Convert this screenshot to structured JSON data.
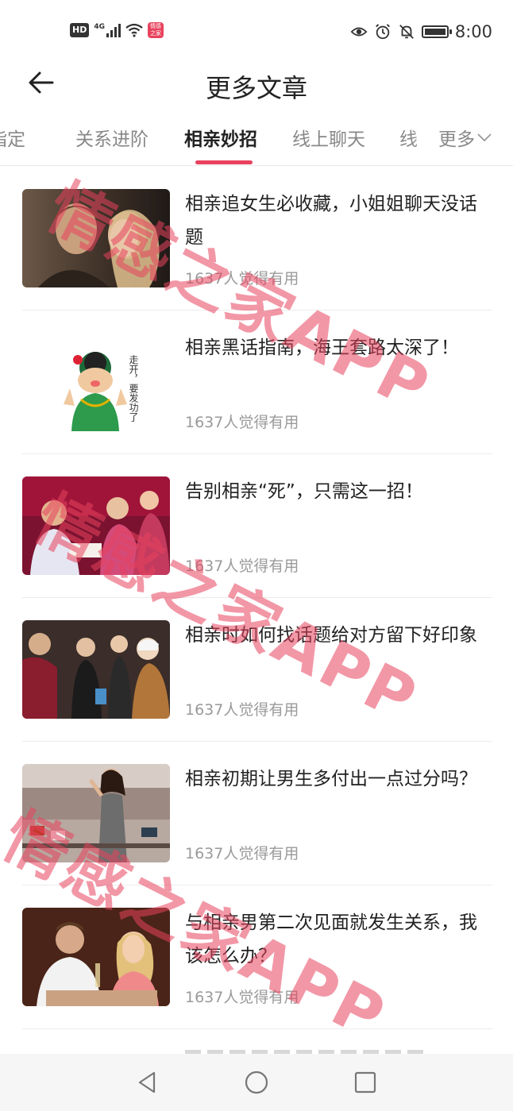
{
  "status_bar": {
    "hd": "HD",
    "network": "4G",
    "app_badge": "情感之家",
    "time": "8:00"
  },
  "header": {
    "title": "更多文章"
  },
  "tabs": [
    {
      "label": "指定"
    },
    {
      "label": "关系进阶"
    },
    {
      "label": "相亲妙招"
    },
    {
      "label": "线上聊天"
    },
    {
      "label": "线"
    }
  ],
  "active_tab": "相亲妙招",
  "more_tab": {
    "label": "更多"
  },
  "articles": [
    {
      "title": "相亲追女生必收藏，小姐姐聊天没话题",
      "meta": "1637人觉得有用"
    },
    {
      "title": "相亲黑话指南，海王套路太深了！",
      "meta": "1637人觉得有用"
    },
    {
      "title": "告别相亲“死”，只需这一招！",
      "meta": "1637人觉得有用"
    },
    {
      "title": "相亲时如何找话题给对方留下好印象",
      "meta": "1637人觉得有用"
    },
    {
      "title": "相亲初期让男生多付出一点过分吗？",
      "meta": "1637人觉得有用"
    },
    {
      "title": "与相亲男第二次见面就发生关系，我该怎么办？",
      "meta": "1637人觉得有用"
    }
  ],
  "sticker_text": "走开，要发功了",
  "watermark": "情感之家APP",
  "accent_color": "#e8425d"
}
